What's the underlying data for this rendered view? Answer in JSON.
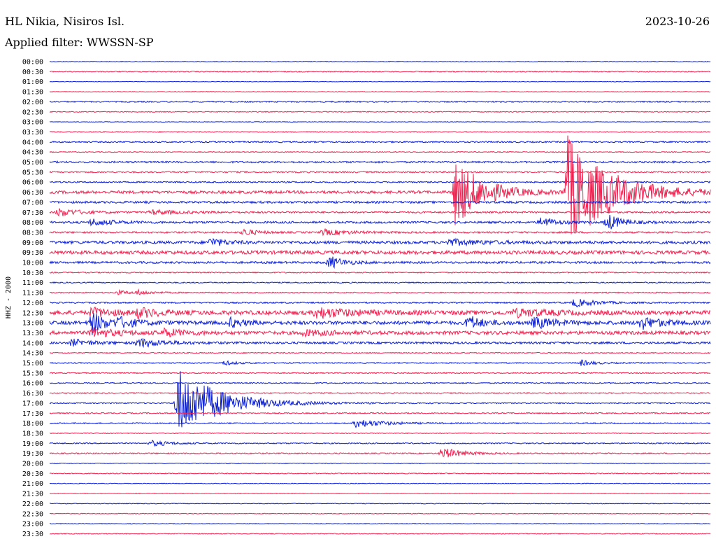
{
  "header": {
    "station": "HL Nikia, Nisiros Isl.",
    "date": "2023-10-26",
    "filter": "Applied filter: WWSSN-SP"
  },
  "colors": {
    "blue": "#0a1ed6",
    "red": "#f0204f"
  },
  "chart_data": {
    "type": "helicorder",
    "ylabel": "HHZ - 2000",
    "row_labels": [
      "00:00",
      "00:30",
      "01:00",
      "01:30",
      "02:00",
      "02:30",
      "03:00",
      "03:30",
      "04:00",
      "04:30",
      "05:00",
      "05:30",
      "06:00",
      "06:30",
      "07:00",
      "07:30",
      "08:00",
      "08:30",
      "09:00",
      "09:30",
      "10:00",
      "10:30",
      "11:00",
      "11:30",
      "12:00",
      "12:30",
      "13:00",
      "13:30",
      "14:00",
      "14:30",
      "15:00",
      "15:30",
      "16:00",
      "16:30",
      "17:00",
      "17:30",
      "18:00",
      "18:30",
      "19:00",
      "19:30",
      "20:00",
      "20:30",
      "21:00",
      "21:30",
      "22:00",
      "22:30",
      "23:00",
      "23:30"
    ],
    "row_colors": [
      "blue",
      "red"
    ],
    "background_noise": [
      0.5,
      0.7,
      0.3,
      0.4,
      0.9,
      0.6,
      0.4,
      0.7,
      1.0,
      0.6,
      1.2,
      1.0,
      1.0,
      2.0,
      1.5,
      1.2,
      1.5,
      1.2,
      2.0,
      2.5,
      1.5,
      0.8,
      0.8,
      0.8,
      1.0,
      3.0,
      2.5,
      2.5,
      1.5,
      0.8,
      0.8,
      0.8,
      0.8,
      0.8,
      0.8,
      0.8,
      0.8,
      0.6,
      0.8,
      0.8,
      0.5,
      0.6,
      0.5,
      0.5,
      0.5,
      0.5,
      0.5,
      0.6
    ],
    "events": [
      {
        "row": 13,
        "t": 0.61,
        "amp": 48,
        "dur": 0.04
      },
      {
        "row": 13,
        "t": 0.78,
        "amp": 80,
        "dur": 0.06
      },
      {
        "row": 15,
        "t": 0.01,
        "amp": 6,
        "dur": 0.03
      },
      {
        "row": 15,
        "t": 0.15,
        "amp": 3,
        "dur": 0.05
      },
      {
        "row": 16,
        "t": 0.06,
        "amp": 5,
        "dur": 0.03
      },
      {
        "row": 16,
        "t": 0.74,
        "amp": 8,
        "dur": 0.02
      },
      {
        "row": 16,
        "t": 0.84,
        "amp": 12,
        "dur": 0.02
      },
      {
        "row": 17,
        "t": 0.29,
        "amp": 5,
        "dur": 0.02
      },
      {
        "row": 17,
        "t": 0.41,
        "amp": 4,
        "dur": 0.04
      },
      {
        "row": 18,
        "t": 0.24,
        "amp": 6,
        "dur": 0.02
      },
      {
        "row": 18,
        "t": 0.6,
        "amp": 4,
        "dur": 0.05
      },
      {
        "row": 20,
        "t": 0.42,
        "amp": 9,
        "dur": 0.02
      },
      {
        "row": 23,
        "t": 0.1,
        "amp": 3,
        "dur": 0.02
      },
      {
        "row": 23,
        "t": 0.13,
        "amp": 3,
        "dur": 0.02
      },
      {
        "row": 24,
        "t": 0.79,
        "amp": 6,
        "dur": 0.03
      },
      {
        "row": 25,
        "t": 0.06,
        "amp": 6,
        "dur": 0.03
      },
      {
        "row": 25,
        "t": 0.13,
        "amp": 6,
        "dur": 0.03
      },
      {
        "row": 25,
        "t": 0.4,
        "amp": 7,
        "dur": 0.05
      },
      {
        "row": 25,
        "t": 0.7,
        "amp": 5,
        "dur": 0.05
      },
      {
        "row": 26,
        "t": 0.06,
        "amp": 16,
        "dur": 0.02
      },
      {
        "row": 26,
        "t": 0.1,
        "amp": 6,
        "dur": 0.03
      },
      {
        "row": 26,
        "t": 0.27,
        "amp": 6,
        "dur": 0.02
      },
      {
        "row": 26,
        "t": 0.63,
        "amp": 10,
        "dur": 0.02
      },
      {
        "row": 26,
        "t": 0.73,
        "amp": 8,
        "dur": 0.03
      },
      {
        "row": 26,
        "t": 0.89,
        "amp": 9,
        "dur": 0.03
      },
      {
        "row": 27,
        "t": 0.06,
        "amp": 6,
        "dur": 0.04
      },
      {
        "row": 27,
        "t": 0.17,
        "amp": 5,
        "dur": 0.03
      },
      {
        "row": 27,
        "t": 0.38,
        "amp": 4,
        "dur": 0.04
      },
      {
        "row": 28,
        "t": 0.03,
        "amp": 5,
        "dur": 0.03
      },
      {
        "row": 28,
        "t": 0.13,
        "amp": 6,
        "dur": 0.04
      },
      {
        "row": 30,
        "t": 0.26,
        "amp": 3,
        "dur": 0.02
      },
      {
        "row": 30,
        "t": 0.8,
        "amp": 4,
        "dur": 0.02
      },
      {
        "row": 34,
        "t": 0.19,
        "amp": 50,
        "dur": 0.06
      },
      {
        "row": 36,
        "t": 0.46,
        "amp": 6,
        "dur": 0.04
      },
      {
        "row": 38,
        "t": 0.15,
        "amp": 4,
        "dur": 0.03
      },
      {
        "row": 39,
        "t": 0.59,
        "amp": 8,
        "dur": 0.03
      }
    ]
  }
}
